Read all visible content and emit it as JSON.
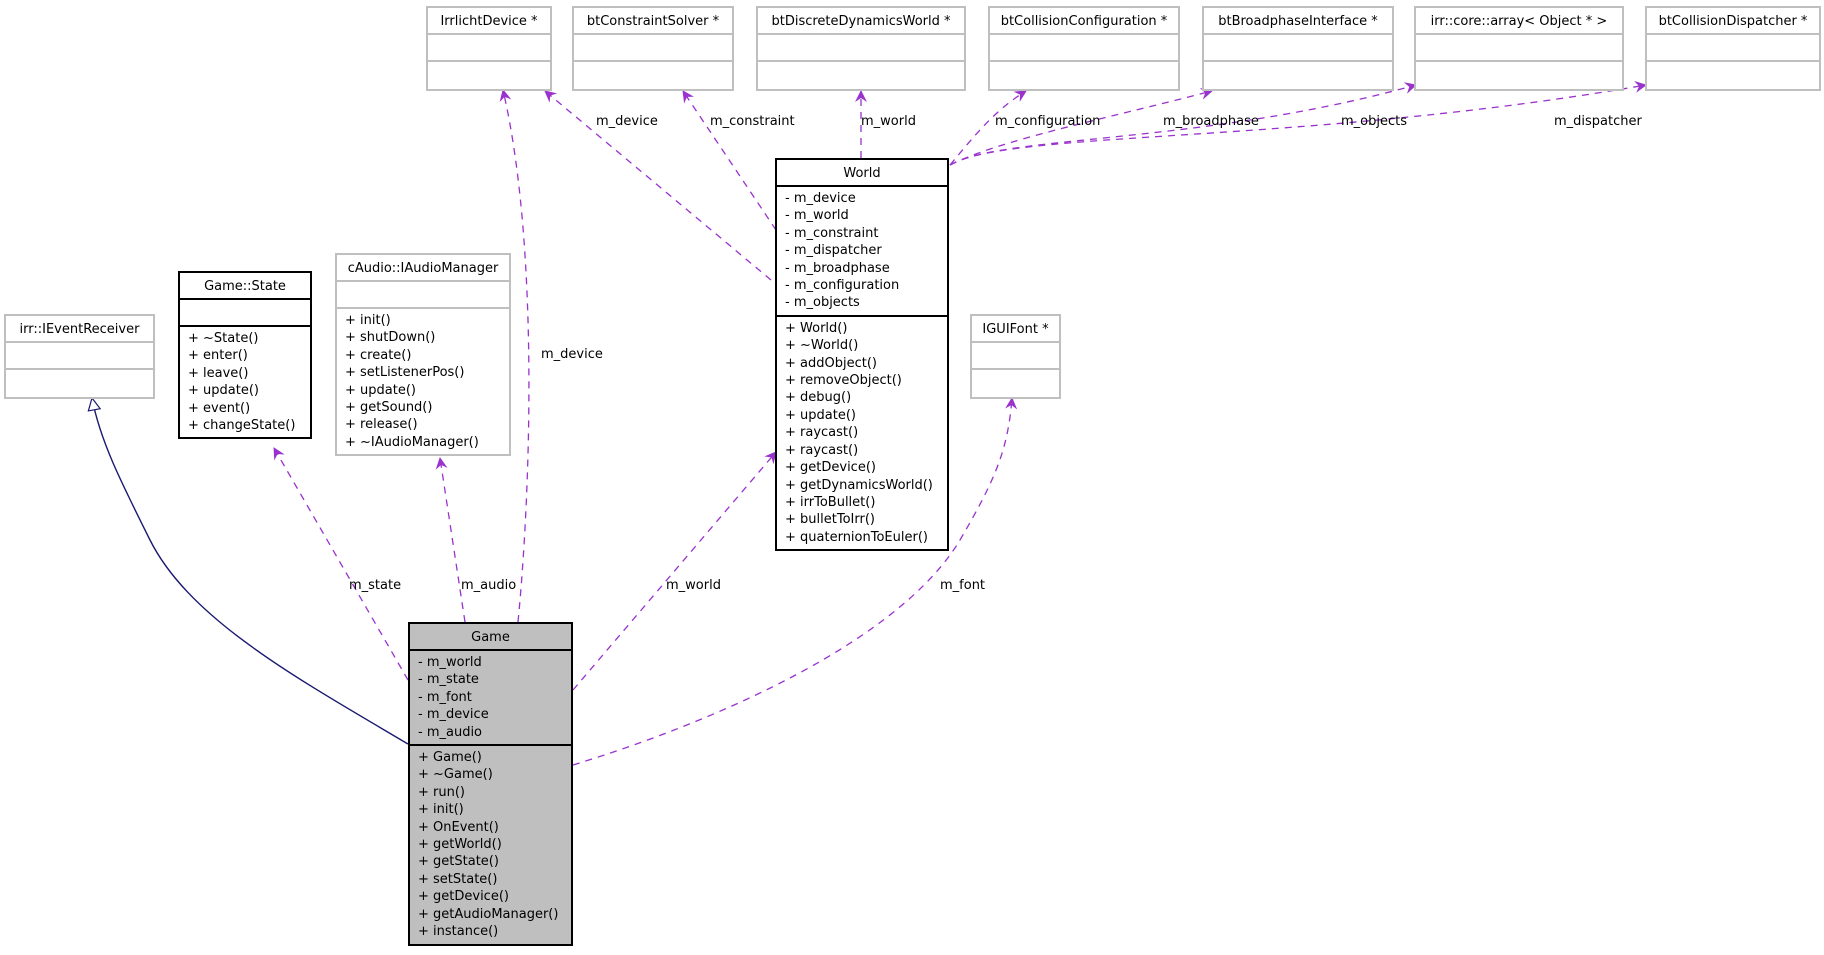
{
  "diagram": {
    "type": "UML collaboration diagram",
    "colors": {
      "association_edge": "#9a32cd",
      "inheritance_edge": "#191970",
      "main_node_fill": "#bfbfbf",
      "undocumented_border": "#bfbfbf",
      "documented_border": "#000000"
    },
    "nodes": {
      "irrlicht_device": {
        "title": "IrrlichtDevice *",
        "attributes": [],
        "methods": []
      },
      "bt_constraint_solver": {
        "title": "btConstraintSolver *",
        "attributes": [],
        "methods": []
      },
      "bt_discrete_dynamics_world": {
        "title": "btDiscreteDynamicsWorld *",
        "attributes": [],
        "methods": []
      },
      "bt_collision_configuration": {
        "title": "btCollisionConfiguration *",
        "attributes": [],
        "methods": []
      },
      "bt_broadphase_interface": {
        "title": "btBroadphaseInterface *",
        "attributes": [],
        "methods": []
      },
      "irr_core_array": {
        "title": "irr::core::array< Object * >",
        "attributes": [],
        "methods": []
      },
      "bt_collision_dispatcher": {
        "title": "btCollisionDispatcher *",
        "attributes": [],
        "methods": []
      },
      "irr_ievent_receiver": {
        "title": "irr::IEventReceiver",
        "attributes": [],
        "methods": []
      },
      "game_state": {
        "title": "Game::State",
        "attributes": [],
        "methods": [
          "+ ~State()",
          "+ enter()",
          "+ leave()",
          "+ update()",
          "+ event()",
          "+ changeState()"
        ]
      },
      "caudio_iaudio_manager": {
        "title": "cAudio::IAudioManager",
        "attributes": [],
        "methods": [
          "+ init()",
          "+ shutDown()",
          "+ create()",
          "+ setListenerPos()",
          "+ update()",
          "+ getSound()",
          "+ release()",
          "+ ~IAudioManager()"
        ]
      },
      "igui_font": {
        "title": "IGUIFont *",
        "attributes": [],
        "methods": []
      },
      "world": {
        "title": "World",
        "attributes": [
          "- m_device",
          "- m_world",
          "- m_constraint",
          "- m_dispatcher",
          "- m_broadphase",
          "- m_configuration",
          "- m_objects"
        ],
        "methods": [
          "+ World()",
          "+ ~World()",
          "+ addObject()",
          "+ removeObject()",
          "+ debug()",
          "+ update()",
          "+ raycast()",
          "+ raycast()",
          "+ getDevice()",
          "+ getDynamicsWorld()",
          "+ irrToBullet()",
          "+ bulletToIrr()",
          "+ quaternionToEuler()"
        ]
      },
      "game": {
        "title": "Game",
        "attributes": [
          "- m_world",
          "- m_state",
          "- m_font",
          "- m_device",
          "- m_audio"
        ],
        "methods": [
          "+ Game()",
          "+ ~Game()",
          "+ run()",
          "+ init()",
          "+ OnEvent()",
          "+ getWorld()",
          "+ getState()",
          "+ setState()",
          "+ getDevice()",
          "+ getAudioManager()",
          "+ instance()"
        ]
      }
    },
    "edges": [
      {
        "id": "game-inherits-ievent",
        "from": "game",
        "to": "irr_ievent_receiver",
        "kind": "inheritance",
        "label": ""
      },
      {
        "id": "game-state",
        "from": "game",
        "to": "game_state",
        "kind": "association",
        "label": "m_state"
      },
      {
        "id": "game-audio",
        "from": "game",
        "to": "caudio_iaudio_manager",
        "kind": "association",
        "label": "m_audio"
      },
      {
        "id": "game-device",
        "from": "game",
        "to": "irrlicht_device",
        "kind": "association",
        "label": "m_device"
      },
      {
        "id": "game-world",
        "from": "game",
        "to": "world",
        "kind": "association",
        "label": "m_world"
      },
      {
        "id": "game-font",
        "from": "game",
        "to": "igui_font",
        "kind": "association",
        "label": "m_font"
      },
      {
        "id": "world-device",
        "from": "world",
        "to": "irrlicht_device",
        "kind": "association",
        "label": "m_device"
      },
      {
        "id": "world-constraint",
        "from": "world",
        "to": "bt_constraint_solver",
        "kind": "association",
        "label": "m_constraint"
      },
      {
        "id": "world-world",
        "from": "world",
        "to": "bt_discrete_dynamics_world",
        "kind": "association",
        "label": "m_world"
      },
      {
        "id": "world-configuration",
        "from": "world",
        "to": "bt_collision_configuration",
        "kind": "association",
        "label": "m_configuration"
      },
      {
        "id": "world-broadphase",
        "from": "world",
        "to": "bt_broadphase_interface",
        "kind": "association",
        "label": "m_broadphase"
      },
      {
        "id": "world-objects",
        "from": "world",
        "to": "irr_core_array",
        "kind": "association",
        "label": "m_objects"
      },
      {
        "id": "world-dispatcher",
        "from": "world",
        "to": "bt_collision_dispatcher",
        "kind": "association",
        "label": "m_dispatcher"
      }
    ]
  }
}
